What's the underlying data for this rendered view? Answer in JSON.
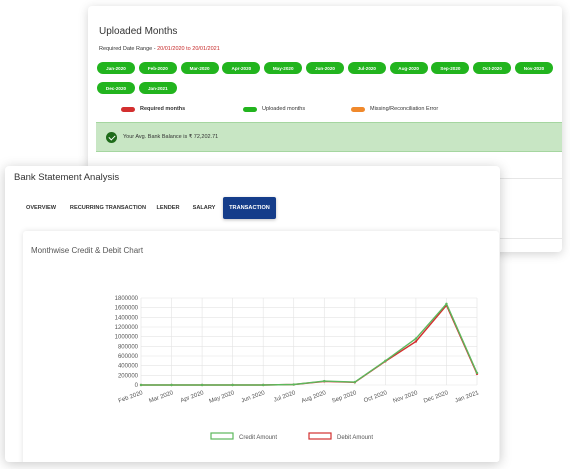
{
  "uploaded": {
    "title": "Uploaded Months",
    "date_range_label": "Required Date Range - ",
    "date_range_value": "20/01/2020 to 20/01/2021",
    "months": [
      "Jan-2020",
      "Feb-2020",
      "Mar-2020",
      "Apr-2020",
      "May-2020",
      "Jun-2020",
      "Jul-2020",
      "Aug-2020",
      "Sep-2020",
      "Oct-2020",
      "Nov-2020",
      "Dec-2020",
      "Jan-2021"
    ],
    "legend": {
      "required": {
        "label": "Required months",
        "color": "#d32f2f"
      },
      "uploaded": {
        "label": "Uploaded months",
        "color": "#22b41e"
      },
      "error": {
        "label": "Missing/Reconciliation Error",
        "color": "#f0892c"
      }
    },
    "balance_text": "Your Avg. Bank Balance is ₹ 72,202.71"
  },
  "analysis": {
    "title": "Bank Statement Analysis",
    "tabs": [
      "OVERVIEW",
      "RECURRING TRANSACTION",
      "LENDER",
      "SALARY",
      "TRANSACTION"
    ],
    "active_tab": "TRANSACTION"
  },
  "chart_data": {
    "type": "line",
    "title": "Monthwise Credit & Debit Chart",
    "categories": [
      "Feb 2020",
      "Mar 2020",
      "Apr 2020",
      "May 2020",
      "Jun 2020",
      "Jul 2020",
      "Aug 2020",
      "Sep 2020",
      "Oct 2020",
      "Nov 2020",
      "Dec 2020",
      "Jan 2021"
    ],
    "y_ticks": [
      "0",
      "200000",
      "400000",
      "600000",
      "800000",
      "1000000",
      "1200000",
      "1400000",
      "1600000",
      "1800000"
    ],
    "ylim": [
      0,
      1800000
    ],
    "series": [
      {
        "name": "Credit Amount",
        "color": "#5cb85c",
        "values": [
          0,
          0,
          0,
          0,
          0,
          10000,
          80000,
          60000,
          500000,
          960000,
          1680000,
          250000
        ]
      },
      {
        "name": "Debit Amount",
        "color": "#d32f2f",
        "values": [
          0,
          0,
          0,
          0,
          0,
          10000,
          75000,
          55000,
          490000,
          900000,
          1650000,
          230000
        ]
      }
    ],
    "grid": true,
    "legend_position": "bottom"
  }
}
